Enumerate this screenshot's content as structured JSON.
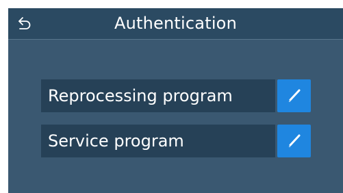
{
  "header": {
    "title": "Authentication",
    "back_icon": "back-arrow-icon"
  },
  "menu": {
    "items": [
      {
        "label": "Reprocessing program",
        "action_icon": "pencil-icon"
      },
      {
        "label": "Service program",
        "action_icon": "pencil-icon"
      }
    ]
  },
  "colors": {
    "background": "#3a5871",
    "header_background": "#2b4a62",
    "row_background": "#264157",
    "accent": "#1f86e0",
    "text": "#ffffff"
  }
}
